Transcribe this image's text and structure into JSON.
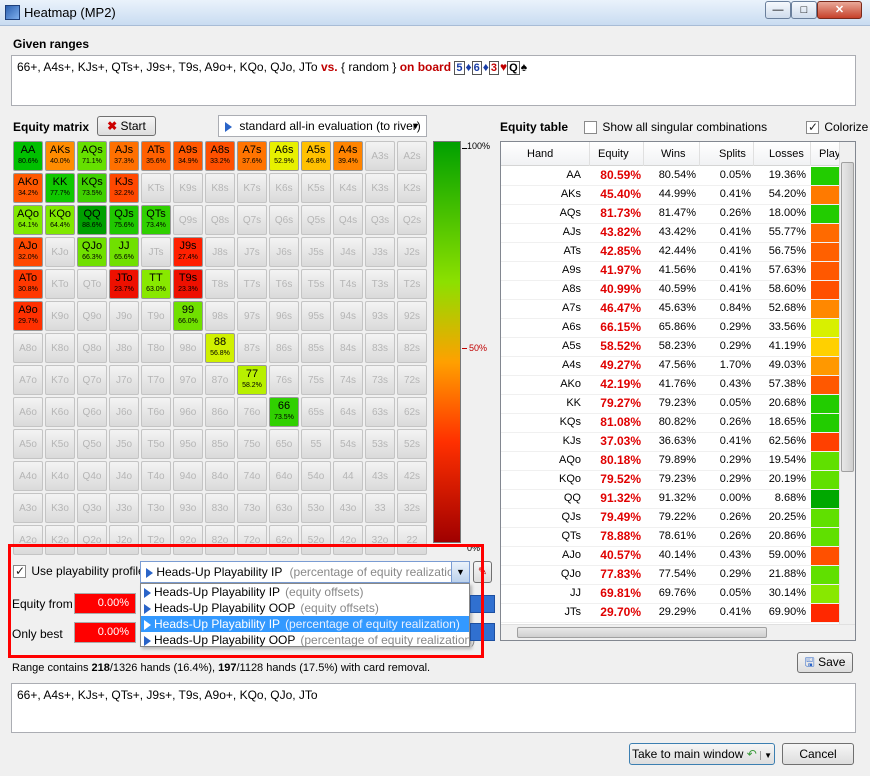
{
  "window": {
    "title": "Heatmap (MP2)"
  },
  "given_ranges": {
    "label": "Given ranges",
    "hero": "66+, A4s+, KJs+, QTs+, J9s+, T9s, A9o+, KQo, QJo, JTo",
    "vs": "vs.",
    "villain": "{ random }",
    "on_board": "on board",
    "board": [
      {
        "rank": "5",
        "suit": "♦",
        "color": "#1a3ea8"
      },
      {
        "rank": "6",
        "suit": "♦",
        "color": "#1a3ea8"
      },
      {
        "rank": "3",
        "suit": "♥",
        "color": "#c00000"
      },
      {
        "rank": "Q",
        "suit": "♠",
        "color": "#000000"
      }
    ]
  },
  "equity_matrix": {
    "label": "Equity matrix",
    "start_label": "Start",
    "eval_mode": "standard all-in evaluation (to river)",
    "scale_top": "100%",
    "scale_mid": "50%",
    "scale_bottom": "0%"
  },
  "matrix": {
    "ranks": [
      "A",
      "K",
      "Q",
      "J",
      "T",
      "9",
      "8",
      "7",
      "6",
      "5",
      "4",
      "3",
      "2"
    ],
    "cells": {
      "0,0": {
        "v": "80.6%",
        "c": "#00c000"
      },
      "0,1": {
        "v": "40.0%",
        "c": "#ff8c00"
      },
      "0,2": {
        "v": "71.1%",
        "c": "#66e000"
      },
      "0,3": {
        "v": "37.3%",
        "c": "#ff7000"
      },
      "0,4": {
        "v": "35.6%",
        "c": "#ff6000"
      },
      "0,5": {
        "v": "34.9%",
        "c": "#ff5800"
      },
      "0,6": {
        "v": "33.2%",
        "c": "#ff5000"
      },
      "0,7": {
        "v": "37.6%",
        "c": "#ff7400"
      },
      "0,8": {
        "v": "52.9%",
        "c": "#e8f000"
      },
      "0,9": {
        "v": "46.8%",
        "c": "#ffc000"
      },
      "0,10": {
        "v": "39.4%",
        "c": "#ff8400"
      },
      "1,0": {
        "v": "34.2%",
        "c": "#ff5800"
      },
      "1,1": {
        "v": "77.7%",
        "c": "#10c800"
      },
      "1,2": {
        "v": "73.5%",
        "c": "#40d000"
      },
      "1,3": {
        "v": "32.2%",
        "c": "#ff4800"
      },
      "2,0": {
        "v": "64.1%",
        "c": "#80e800"
      },
      "2,1": {
        "v": "64.4%",
        "c": "#80e800"
      },
      "2,2": {
        "v": "88.6%",
        "c": "#00a000"
      },
      "2,3": {
        "v": "75.6%",
        "c": "#20c800"
      },
      "2,4": {
        "v": "73.4%",
        "c": "#30d000"
      },
      "3,0": {
        "v": "32.0%",
        "c": "#ff4800"
      },
      "3,2": {
        "v": "66.3%",
        "c": "#70e000"
      },
      "3,3": {
        "v": "65.6%",
        "c": "#70e000"
      },
      "3,5": {
        "v": "27.4%",
        "c": "#ff2000"
      },
      "4,0": {
        "v": "30.8%",
        "c": "#ff3800"
      },
      "4,3": {
        "v": "23.7%",
        "c": "#ee1000"
      },
      "4,4": {
        "v": "63.0%",
        "c": "#88e800"
      },
      "4,5": {
        "v": "23.3%",
        "c": "#ee1000"
      },
      "5,0": {
        "v": "29.7%",
        "c": "#ff3000"
      },
      "5,5": {
        "v": "66.0%",
        "c": "#70e000"
      },
      "6,6": {
        "v": "56.8%",
        "c": "#d0f000"
      },
      "7,7": {
        "v": "58.2%",
        "c": "#b8f000"
      },
      "8,8": {
        "v": "73.5%",
        "c": "#30d000"
      }
    }
  },
  "playability": {
    "checkbox_label": "Use playability profile:",
    "selected": "Heads-Up Playability IP",
    "selected_hint": "(percentage of equity realization)",
    "options": [
      {
        "name": "Heads-Up Playability IP",
        "hint": "(equity offsets)"
      },
      {
        "name": "Heads-Up Playability OOP",
        "hint": "(equity offsets)"
      },
      {
        "name": "Heads-Up Playability IP",
        "hint": "(percentage of equity realization)"
      },
      {
        "name": "Heads-Up Playability OOP",
        "hint": "(percentage of equity realization)"
      }
    ],
    "equity_from_label": "Equity from",
    "equity_from_value": "0.00%",
    "only_best_label": "Only best",
    "only_best_value": "0.00%"
  },
  "equity_table": {
    "label": "Equity table",
    "show_all_label": "Show all singular combinations",
    "colorize_label": "Colorize",
    "columns": [
      "Hand",
      "Equity",
      "Wins",
      "Splits",
      "Losses",
      "Play"
    ],
    "rows": [
      {
        "hand": "AA",
        "equity": "80.59%",
        "wins": "80.54%",
        "splits": "0.05%",
        "losses": "19.36%",
        "color": "#22cc00"
      },
      {
        "hand": "AKs",
        "equity": "45.40%",
        "wins": "44.99%",
        "splits": "0.41%",
        "losses": "54.20%",
        "color": "#ff7a00"
      },
      {
        "hand": "AQs",
        "equity": "81.73%",
        "wins": "81.47%",
        "splits": "0.26%",
        "losses": "18.00%",
        "color": "#22cc00"
      },
      {
        "hand": "AJs",
        "equity": "43.82%",
        "wins": "43.42%",
        "splits": "0.41%",
        "losses": "55.77%",
        "color": "#ff6a00"
      },
      {
        "hand": "ATs",
        "equity": "42.85%",
        "wins": "42.44%",
        "splits": "0.41%",
        "losses": "56.75%",
        "color": "#ff6000"
      },
      {
        "hand": "A9s",
        "equity": "41.97%",
        "wins": "41.56%",
        "splits": "0.41%",
        "losses": "57.63%",
        "color": "#ff5800"
      },
      {
        "hand": "A8s",
        "equity": "40.99%",
        "wins": "40.59%",
        "splits": "0.41%",
        "losses": "58.60%",
        "color": "#ff5000"
      },
      {
        "hand": "A7s",
        "equity": "46.47%",
        "wins": "45.63%",
        "splits": "0.84%",
        "losses": "52.68%",
        "color": "#ff8800"
      },
      {
        "hand": "A6s",
        "equity": "66.15%",
        "wins": "65.86%",
        "splits": "0.29%",
        "losses": "33.56%",
        "color": "#d8f000"
      },
      {
        "hand": "A5s",
        "equity": "58.52%",
        "wins": "58.23%",
        "splits": "0.29%",
        "losses": "41.19%",
        "color": "#ffd000"
      },
      {
        "hand": "A4s",
        "equity": "49.27%",
        "wins": "47.56%",
        "splits": "1.70%",
        "losses": "49.03%",
        "color": "#ff9800"
      },
      {
        "hand": "AKo",
        "equity": "42.19%",
        "wins": "41.76%",
        "splits": "0.43%",
        "losses": "57.38%",
        "color": "#ff5800"
      },
      {
        "hand": "KK",
        "equity": "79.27%",
        "wins": "79.23%",
        "splits": "0.05%",
        "losses": "20.68%",
        "color": "#22cc00"
      },
      {
        "hand": "KQs",
        "equity": "81.08%",
        "wins": "80.82%",
        "splits": "0.26%",
        "losses": "18.65%",
        "color": "#22cc00"
      },
      {
        "hand": "KJs",
        "equity": "37.03%",
        "wins": "36.63%",
        "splits": "0.41%",
        "losses": "62.56%",
        "color": "#ff4000"
      },
      {
        "hand": "AQo",
        "equity": "80.18%",
        "wins": "79.89%",
        "splits": "0.29%",
        "losses": "19.54%",
        "color": "#60e000"
      },
      {
        "hand": "KQo",
        "equity": "79.52%",
        "wins": "79.23%",
        "splits": "0.29%",
        "losses": "20.19%",
        "color": "#60e000"
      },
      {
        "hand": "QQ",
        "equity": "91.32%",
        "wins": "91.32%",
        "splits": "0.00%",
        "losses": "8.68%",
        "color": "#00a800"
      },
      {
        "hand": "QJs",
        "equity": "79.49%",
        "wins": "79.22%",
        "splits": "0.26%",
        "losses": "20.25%",
        "color": "#60e000"
      },
      {
        "hand": "QTs",
        "equity": "78.88%",
        "wins": "78.61%",
        "splits": "0.26%",
        "losses": "20.86%",
        "color": "#60e000"
      },
      {
        "hand": "AJo",
        "equity": "40.57%",
        "wins": "40.14%",
        "splits": "0.43%",
        "losses": "59.00%",
        "color": "#ff5000"
      },
      {
        "hand": "QJo",
        "equity": "77.83%",
        "wins": "77.54%",
        "splits": "0.29%",
        "losses": "21.88%",
        "color": "#60e000"
      },
      {
        "hand": "JJ",
        "equity": "69.81%",
        "wins": "69.76%",
        "splits": "0.05%",
        "losses": "30.14%",
        "color": "#88e800"
      },
      {
        "hand": "JTs",
        "equity": "29.70%",
        "wins": "29.29%",
        "splits": "0.41%",
        "losses": "69.90%",
        "color": "#ff2800"
      }
    ],
    "save_label": "Save"
  },
  "summary": {
    "prefix": "Range contains ",
    "count1": "218",
    "mid1": "/1326 hands (16.4%), ",
    "count2": "197",
    "mid2": "/1128 hands (17.5%) with card removal."
  },
  "output_range": "66+, A4s+, KJs+, QTs+, J9s+, T9s, A9o+, KQo, QJo, JTo",
  "footer": {
    "main_window_label": "Take to main window",
    "cancel_label": "Cancel"
  }
}
